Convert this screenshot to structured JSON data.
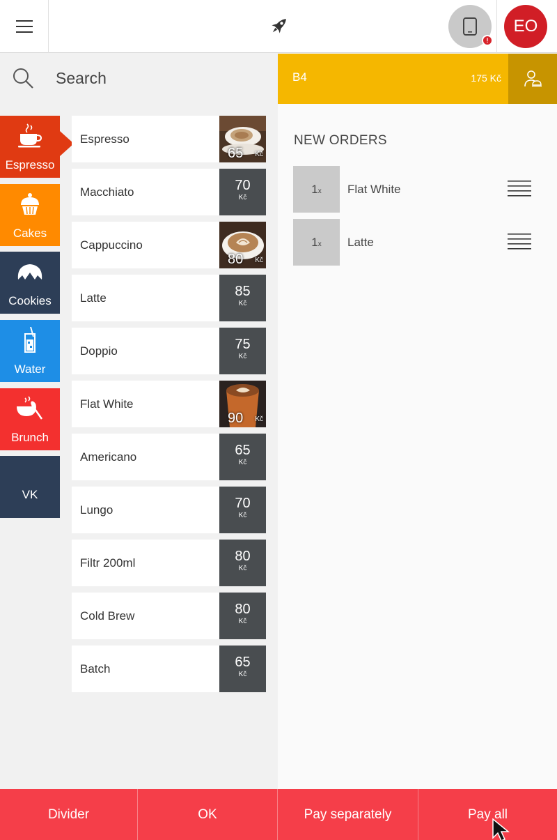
{
  "header": {
    "menu_icon": "hamburger-icon",
    "logo_icon": "rocket-icon",
    "device_icon": "tablet-icon",
    "alert_badge": "!",
    "user_initials": "EO"
  },
  "search": {
    "label": "Search"
  },
  "categories": [
    {
      "label": "Espresso",
      "color": "#e03a12",
      "icon": "coffee-cup-icon",
      "active": true
    },
    {
      "label": "Cakes",
      "color": "#ff8a00",
      "icon": "cupcake-icon"
    },
    {
      "label": "Cookies",
      "color": "#2d3e57",
      "icon": "croissant-icon"
    },
    {
      "label": "Water",
      "color": "#1e8ee6",
      "icon": "drink-icon"
    },
    {
      "label": "Brunch",
      "color": "#f3302f",
      "icon": "bowl-icon"
    },
    {
      "label": "VK",
      "color": "#2d3e57"
    }
  ],
  "products": [
    {
      "name": "Espresso",
      "price": "65",
      "currency": "Kč",
      "image": "espresso-photo"
    },
    {
      "name": "Macchiato",
      "price": "70",
      "currency": "Kč"
    },
    {
      "name": "Cappuccino",
      "price": "80",
      "currency": "Kč",
      "image": "cappuccino-photo"
    },
    {
      "name": "Latte",
      "price": "85",
      "currency": "Kč"
    },
    {
      "name": "Doppio",
      "price": "75",
      "currency": "Kč"
    },
    {
      "name": "Flat White",
      "price": "90",
      "currency": "Kč",
      "image": "flat-white-photo"
    },
    {
      "name": "Americano",
      "price": "65",
      "currency": "Kč"
    },
    {
      "name": "Lungo",
      "price": "70",
      "currency": "Kč"
    },
    {
      "name": "Filtr 200ml",
      "price": "80",
      "currency": "Kč"
    },
    {
      "name": "Cold Brew",
      "price": "80",
      "currency": "Kč"
    },
    {
      "name": "Batch",
      "price": "65",
      "currency": "Kč"
    }
  ],
  "table": {
    "name": "B4",
    "total": "175 Kč",
    "accent": "#f5b700"
  },
  "orders": {
    "title": "NEW ORDERS",
    "items": [
      {
        "qty": "1",
        "unit": "x",
        "name": "Flat White"
      },
      {
        "qty": "1",
        "unit": "x",
        "name": "Latte"
      }
    ]
  },
  "footer": {
    "divider": "Divider",
    "ok": "OK",
    "pay_separately": "Pay separately",
    "pay_all": "Pay all",
    "color": "#f53e49"
  }
}
